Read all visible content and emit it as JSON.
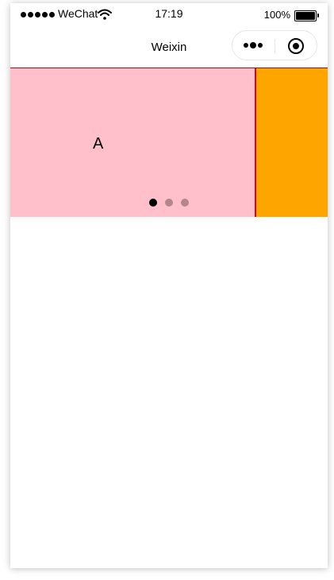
{
  "status_bar": {
    "carrier": "WeChat",
    "time": "17:19",
    "battery": "100%",
    "signal_icon": "signal-dots-icon",
    "wifi_icon": "wifi-icon",
    "battery_icon": "battery-icon"
  },
  "nav": {
    "title": "Weixin",
    "more_icon": "more-dots-icon",
    "close_icon": "target-close-icon"
  },
  "swiper": {
    "slides": [
      {
        "label": "A",
        "color": "#ffc0cb"
      },
      {
        "label": "",
        "color": "#ffa500"
      }
    ],
    "indicator_count": 3,
    "active_index": 0,
    "indicator_active_color": "#000000",
    "indicator_inactive_color": "rgba(0,0,0,0.3)",
    "border_color": "#e0001a"
  }
}
